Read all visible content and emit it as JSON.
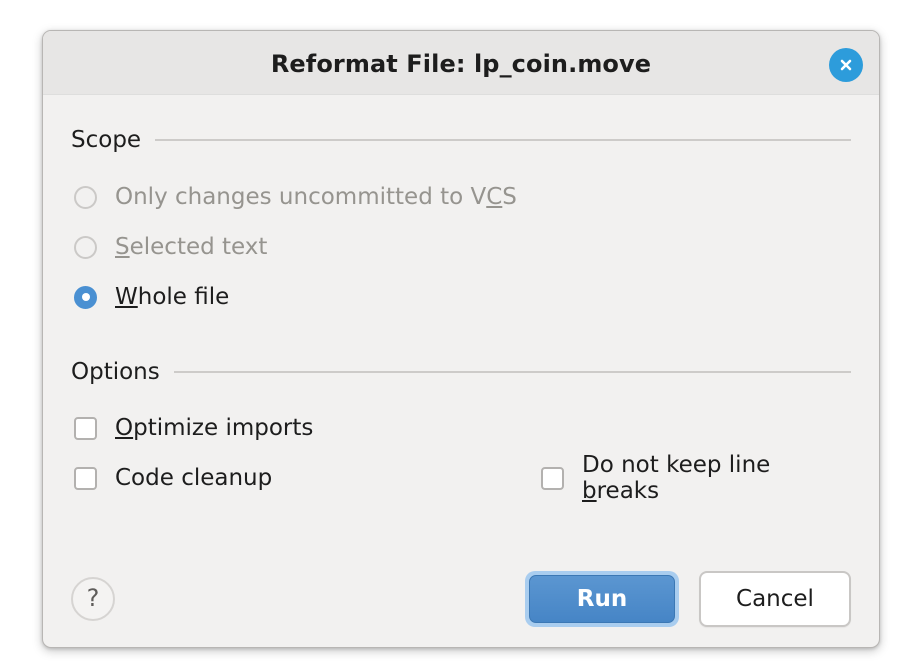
{
  "dialog": {
    "title": "Reformat File: lp_coin.move",
    "close_icon": "close-circle-icon"
  },
  "scope": {
    "header": "Scope",
    "options": [
      {
        "label": "Only changes uncommitted to VCS",
        "mnemonic_prefix": "Only changes uncommitted to V",
        "mnemonic_char": "C",
        "mnemonic_suffix": "S",
        "selected": false,
        "enabled": false
      },
      {
        "label": "Selected text",
        "mnemonic_prefix": "",
        "mnemonic_char": "S",
        "mnemonic_suffix": "elected text",
        "selected": false,
        "enabled": false
      },
      {
        "label": "Whole file",
        "mnemonic_prefix": "",
        "mnemonic_char": "W",
        "mnemonic_suffix": "hole file",
        "selected": true,
        "enabled": true
      }
    ]
  },
  "options": {
    "header": "Options",
    "optimize_imports": {
      "mnemonic_prefix": "",
      "mnemonic_char": "O",
      "mnemonic_suffix": "ptimize imports",
      "checked": false
    },
    "code_cleanup": {
      "mnemonic_prefix": "Code cleanup",
      "mnemonic_char": "",
      "mnemonic_suffix": "",
      "checked": false
    },
    "do_not_keep_line_breaks": {
      "mnemonic_prefix": "Do not keep line ",
      "mnemonic_char": "b",
      "mnemonic_suffix": "reaks",
      "checked": false
    }
  },
  "footer": {
    "help_label": "?",
    "run_label": "Run",
    "cancel_label": "Cancel"
  },
  "colors": {
    "accent": "#4a90d2",
    "run_button": "#4a86c8",
    "focus_ring": "#a9cdef",
    "close_button": "#2d9cdb",
    "dialog_bg": "#f2f1f0",
    "titlebar_bg": "#e7e6e5"
  }
}
